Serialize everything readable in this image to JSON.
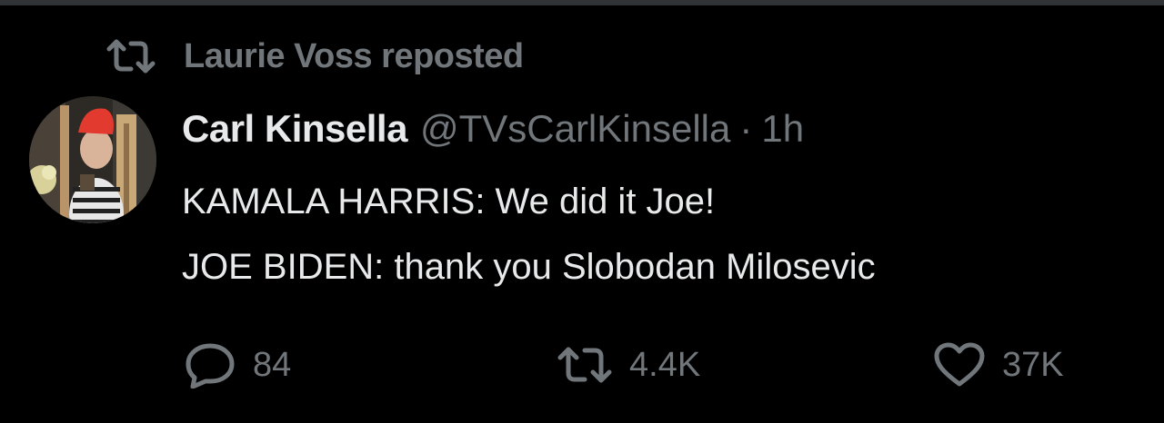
{
  "colors": {
    "background": "#000000",
    "primary_text": "#e7e9ea",
    "secondary_text": "#71767b",
    "border": "#2f3336"
  },
  "repost_banner": {
    "label": "Laurie Voss reposted",
    "icon": "repost-icon"
  },
  "tweet": {
    "author": {
      "display_name": "Carl Kinsella",
      "handle": "@TVsCarlKinsella",
      "avatar": "avatar-image"
    },
    "separator": "·",
    "time": "1h",
    "lines": [
      "KAMALA HARRIS: We did it Joe!",
      "JOE BIDEN: thank you Slobodan Milosevic"
    ],
    "actions": {
      "reply": {
        "icon": "reply-icon",
        "count": "84"
      },
      "repost": {
        "icon": "repost-icon",
        "count": "4.4K"
      },
      "like": {
        "icon": "heart-icon",
        "count": "37K"
      }
    }
  }
}
